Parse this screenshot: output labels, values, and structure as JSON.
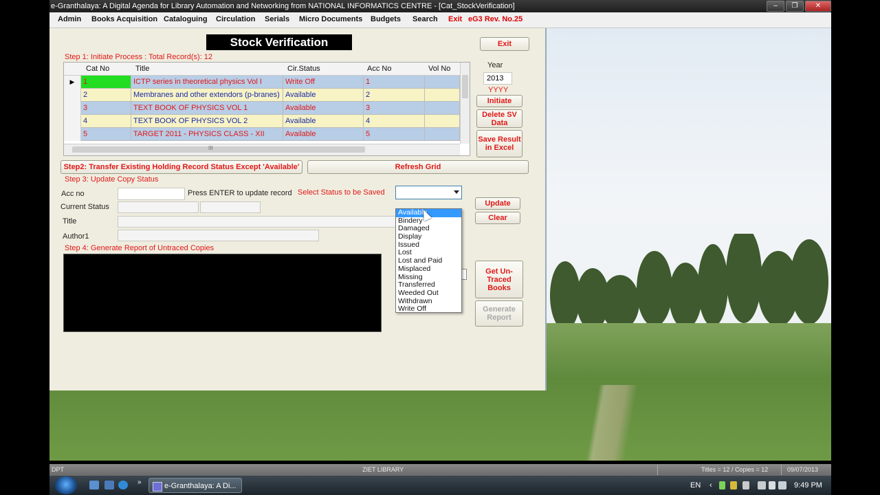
{
  "window": {
    "title": "e-Granthalaya: A Digital Agenda for Library Automation and Networking from NATIONAL INFORMATICS CENTRE - [Cat_StockVerification]",
    "controls": [
      "‒",
      "❐",
      "✕"
    ]
  },
  "menu": {
    "items": [
      "Admin",
      "Books Acquisition",
      "Cataloguing",
      "Circulation",
      "Serials",
      "Micro Documents",
      "Budgets",
      "Search"
    ],
    "exit": "Exit",
    "version": "eG3 Rev. No.25"
  },
  "form": {
    "heading": "Stock Verification",
    "exit_button": "Exit",
    "step1": "Step 1: Initiate Process : Total Record(s): 12",
    "year_label": "Year",
    "year_value": "2013",
    "year_hint": "YYYY",
    "initiate_button": "Initiate",
    "delete_button": "Delete SV Data",
    "save_button": "Save Result in Excel",
    "grid": {
      "columns": [
        "Cat No",
        "Title",
        "Cir.Status",
        "Acc No",
        "Vol No"
      ],
      "current_row_marker": "▶",
      "hscroll_grip": "III",
      "rows": [
        {
          "cat": "1",
          "title": "ICTP series in theoretical physics Vol I",
          "status": "Write Off",
          "acc": "1",
          "vol": ""
        },
        {
          "cat": "2",
          "title": "Membranes and other extendors (p-branes)",
          "status": "Available",
          "acc": "2",
          "vol": ""
        },
        {
          "cat": "3",
          "title": "TEXT BOOK OF PHYSICS VOL 1",
          "status": "Available",
          "acc": "3",
          "vol": ""
        },
        {
          "cat": "4",
          "title": "TEXT BOOK OF PHYSICS VOL 2",
          "status": "Available",
          "acc": "4",
          "vol": ""
        },
        {
          "cat": "5",
          "title": "TARGET 2011 - PHYSICS CLASS - XII",
          "status": "Available",
          "acc": "5",
          "vol": ""
        }
      ]
    },
    "step2_button": "Step2: Transfer Existing Holding Record Status Except 'Available'",
    "refresh_button": "Refresh Grid",
    "step3": "Step 3: Update Copy Status",
    "acc_no_label": "Acc no",
    "press_enter": "Press ENTER to update record",
    "select_status_label": "Select Status to be Saved",
    "current_status_label": "Current Status",
    "title_label": "Title",
    "author_label": "Author1",
    "update_button": "Update",
    "clear_button": "Clear",
    "status_options": [
      "Available",
      "Bindery",
      "Damaged",
      "Display",
      "Issued",
      "Lost",
      "Lost and Paid",
      "Misplaced",
      "Missing",
      "Transferred",
      "Weeded Out",
      "Withdrawn",
      "Write Off"
    ],
    "highlighted_option": "Available",
    "step4": "Step 4: Generate Report of Untraced Copies",
    "get_untraced_button": "Get Un-Traced Books",
    "generate_report_button": "Generate Report"
  },
  "statusbar": {
    "left": "DPT",
    "center": "ZIET LIBRARY",
    "counts": "Titles = 12 / Copies = 12",
    "date": "09/07/2013"
  },
  "taskbar": {
    "task_label": "e-Granthalaya: A Di...",
    "quick_launch_more": "»",
    "lang": "EN",
    "time": "9:49 PM"
  },
  "colors": {
    "grid_row_blue": "#b8cde6",
    "grid_row_yellow": "#f7f3c4",
    "red_text": "#e01818",
    "blue_text": "#1a2aa8",
    "selected_cell": "#22dd22",
    "highlight": "#3399ff"
  }
}
